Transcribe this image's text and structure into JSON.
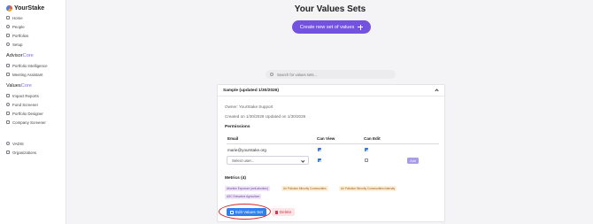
{
  "brand": {
    "name": "YourStake"
  },
  "sidebar": {
    "main_items": [
      {
        "label": "Home",
        "icon": "home-icon"
      },
      {
        "label": "People",
        "icon": "people-icon"
      },
      {
        "label": "Portfolios",
        "icon": "portfolio-icon"
      },
      {
        "label": "Setup",
        "icon": "gear-icon"
      }
    ],
    "advisor_core": {
      "title_main": "Advisor",
      "title_accent": "Core",
      "items": [
        {
          "label": "Portfolio Intelligence",
          "icon": "chart-icon"
        },
        {
          "label": "Meeting Assistant",
          "icon": "assistant-icon"
        }
      ]
    },
    "values_core": {
      "title_main": "Values",
      "title_accent": "Core",
      "items": [
        {
          "label": "Impact Reports",
          "icon": "report-icon"
        },
        {
          "label": "Fund Screener",
          "icon": "search-icon"
        },
        {
          "label": "Portfolio Designer",
          "icon": "designer-icon"
        },
        {
          "label": "Company Screener",
          "icon": "building-icon"
        }
      ]
    },
    "bottom_items": [
      {
        "label": "VADIS",
        "icon": "group-icon"
      },
      {
        "label": "Organizations",
        "icon": "organization-icon"
      }
    ]
  },
  "main": {
    "title": "Your Values Sets",
    "create_button_label": "Create new set of values",
    "search_placeholder": "Search for values sets..."
  },
  "card": {
    "title": "Sample (updated 1/30/2026)",
    "owner": "Owner: YourStake Support",
    "dates": "Created on 1/30/2026 Updated on 1/30/2026",
    "permissions_title": "Permissions",
    "columns": [
      "Email",
      "Can View",
      "Can Edit"
    ],
    "rows": [
      {
        "email": "marie@yourstake.org",
        "can_view": true,
        "can_edit": true
      }
    ],
    "select_placeholder": "Select user...",
    "new_row": {
      "can_view": true,
      "can_edit": false
    },
    "add_button_label": "Add",
    "metrics_title": "Metrics (4)",
    "metrics": [
      {
        "label": "Abortion Exposure (anti-abortion)",
        "color": "purple"
      },
      {
        "label": "Air Pollution Minority Communities",
        "color": "orange"
      },
      {
        "label": "Air Pollution Minority Communities intensity",
        "color": "orange"
      },
      {
        "label": "ASC Extractive Agriculture",
        "color": "purple"
      }
    ],
    "edit_button_label": "Edit Values Set",
    "delete_button_label": "Delete"
  },
  "colors": {
    "accent": "#7352e0",
    "primary_button": "#2e7ff0",
    "delete_bg": "#fde4e6",
    "highlight_circle": "#d42a2a"
  }
}
